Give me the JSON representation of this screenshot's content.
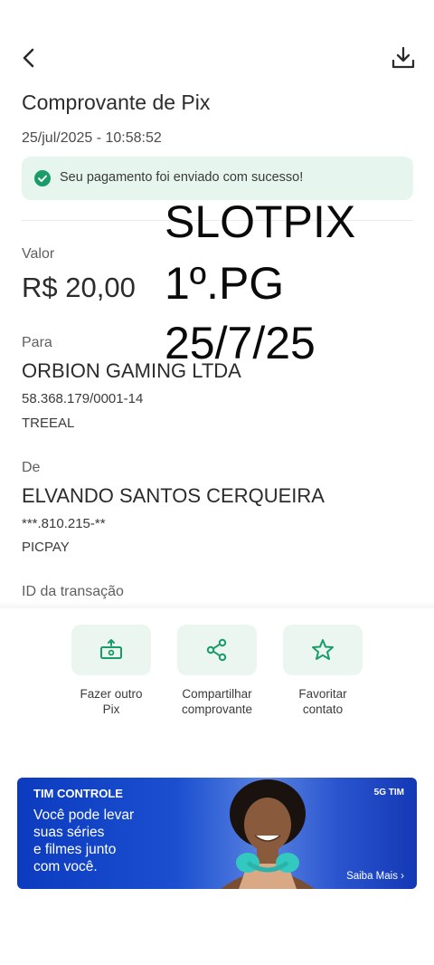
{
  "header": {
    "back_icon": "chevron-left-icon",
    "download_icon": "download-icon",
    "title": "Comprovante de Pix",
    "datetime": "25/jul/2025 - 10:58:52"
  },
  "status": {
    "icon": "check-circle-icon",
    "message": "Seu pagamento foi enviado com sucesso!",
    "color": "#1a9c68"
  },
  "overlay": {
    "line1": "SLOTPIX",
    "line2": "1º.PG",
    "line3": "25/7/25"
  },
  "valor": {
    "label": "Valor",
    "amount": "R$ 20,00"
  },
  "para": {
    "label": "Para",
    "name": "ORBION GAMING LTDA",
    "document": "58.368.179/0001-14",
    "institution": "TREEAL"
  },
  "de": {
    "label": "De",
    "name": "ELVANDO SANTOS CERQUEIRA",
    "document": "***.810.215-**",
    "institution": "PICPAY"
  },
  "transaction": {
    "label": "ID da transação"
  },
  "actions": [
    {
      "label": "Fazer outro\nPix",
      "icon": "send-money-icon"
    },
    {
      "label": "Compartilhar\ncomprovante",
      "icon": "share-icon"
    },
    {
      "label": "Favoritar\ncontato",
      "icon": "star-icon"
    }
  ],
  "banner": {
    "brand": "TIM CONTROLE",
    "copy": "Você pode levar\nsuas séries\ne filmes junto\ncom você.",
    "badge": "5G TIM",
    "cta": "Saiba Mais"
  },
  "colors": {
    "accent": "#1a9c68",
    "success_bg": "#e6f5ee",
    "action_bg": "#ecf6f1",
    "banner_blue": "#1b4fd0"
  }
}
